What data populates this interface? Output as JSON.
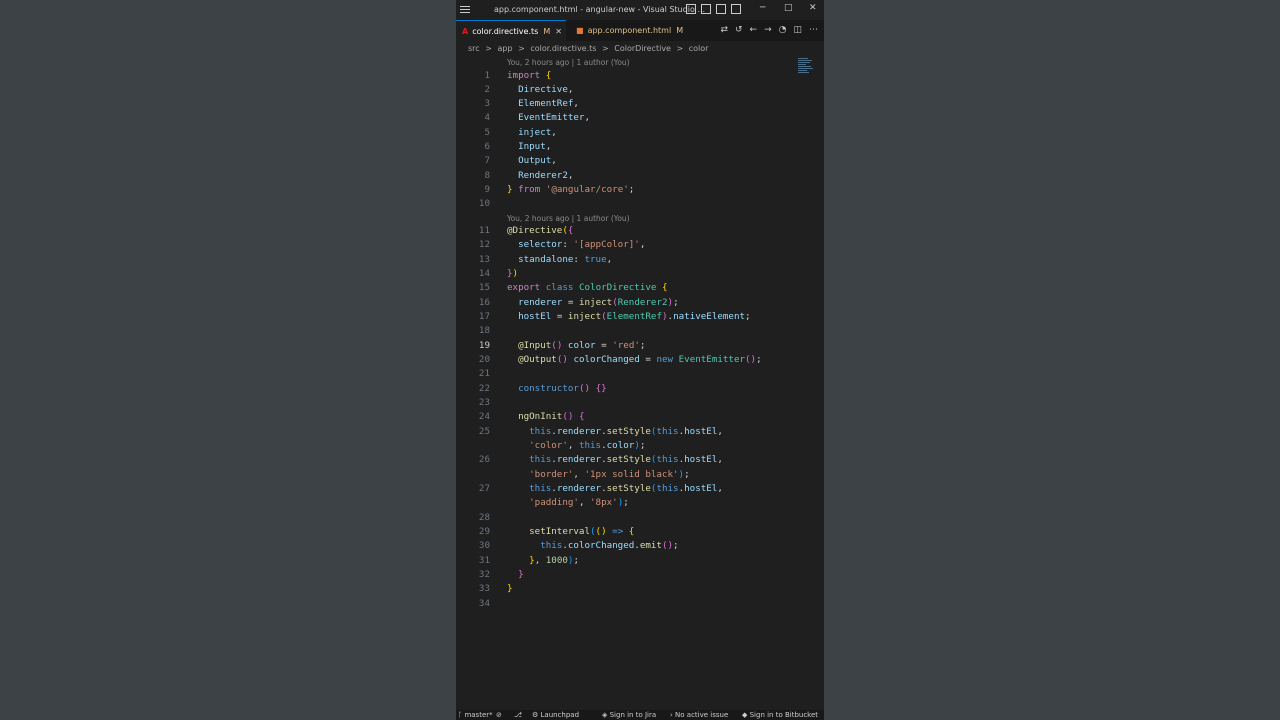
{
  "titlebar": {
    "title": "app.component.html - angular-new - Visual Studio ..."
  },
  "tabs": [
    {
      "label": "color.directive.ts",
      "modified": "M",
      "icon": "angular-icon",
      "active": true
    },
    {
      "label": "app.component.html",
      "modified": "M",
      "icon": "html-icon",
      "active": false
    }
  ],
  "breadcrumb": [
    "src",
    ">",
    "app",
    ">",
    "color.directive.ts",
    ">",
    "ColorDirective",
    ">",
    "color"
  ],
  "codelens": [
    "You, 2 hours ago | 1 author (You)",
    "You, 2 hours ago | 1 author (You)"
  ],
  "lines": [
    "1",
    "2",
    "3",
    "4",
    "5",
    "6",
    "7",
    "8",
    "9",
    "10",
    "11",
    "12",
    "13",
    "14",
    "15",
    "16",
    "17",
    "18",
    "19",
    "20",
    "21",
    "22",
    "23",
    "24",
    "25",
    "26",
    "27",
    "28",
    "29",
    "30",
    "31",
    "32",
    "33",
    "34"
  ],
  "statusbar": {
    "branch": "master*",
    "launchpad": "Launchpad",
    "jira": "Sign in to Jira",
    "issue": "No active issue",
    "bitbucket": "Sign in to Bitbucket"
  },
  "colors": {
    "accent": "#0078d4",
    "editor_bg": "#1f1f1f",
    "desktop_bg": "#3d4247"
  }
}
